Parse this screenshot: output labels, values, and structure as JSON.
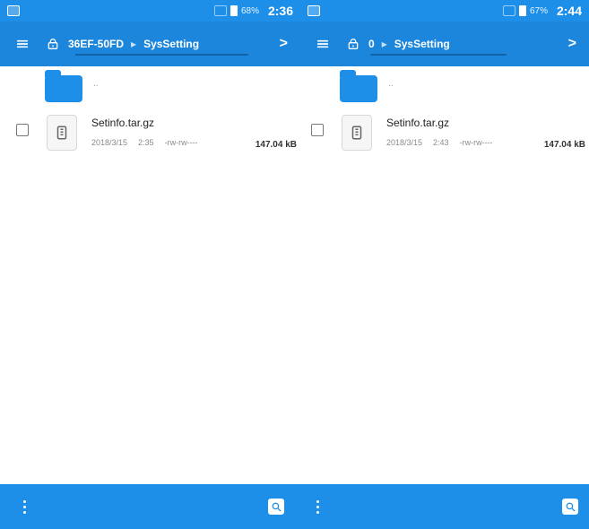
{
  "panes": [
    {
      "status": {
        "battery": "68%",
        "time": "2:36"
      },
      "breadcrumb": {
        "root": "36EF-50FD",
        "current": "SysSetting",
        "chevron": ">"
      },
      "parent_folder_label": "..",
      "file": {
        "name": "Setinfo.tar.gz",
        "date": "2018/3/15",
        "time": "2:35",
        "perm": "-rw-rw----",
        "size": "147.04 kB"
      }
    },
    {
      "status": {
        "battery": "67%",
        "time": "2:44"
      },
      "breadcrumb": {
        "root": "0",
        "current": "SysSetting",
        "chevron": ">"
      },
      "parent_folder_label": "..",
      "file": {
        "name": "Setinfo.tar.gz",
        "date": "2018/3/15",
        "time": "2:43",
        "perm": "-rw-rw----",
        "size": "147.04 kB"
      }
    }
  ],
  "icons": {
    "menu": "menu-icon",
    "lock": "lock-icon",
    "kebab": "more-options-icon",
    "search": "search-icon",
    "archive": "archive-file-icon",
    "folder": "folder-icon"
  },
  "colors": {
    "accent": "#1E8FE8"
  }
}
